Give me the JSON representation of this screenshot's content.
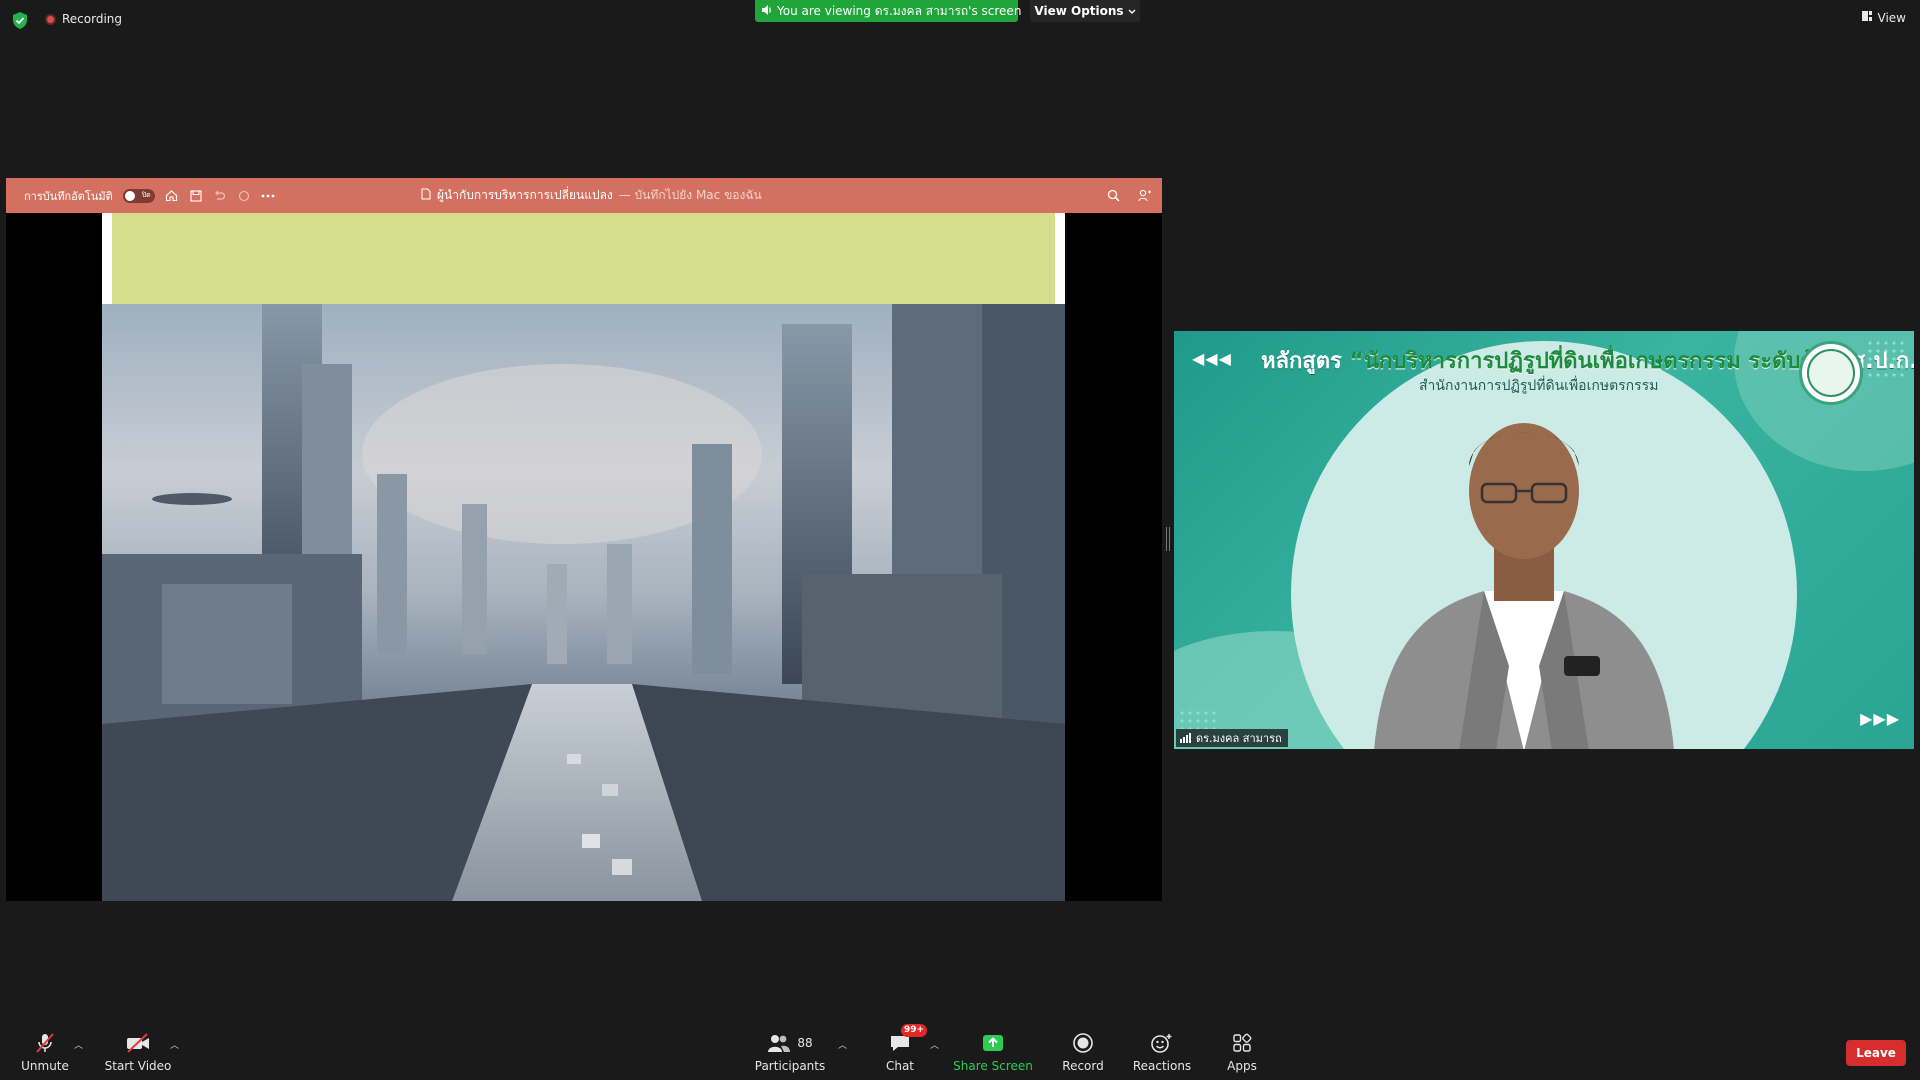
{
  "topbar": {
    "recording_label": "Recording",
    "viewing_banner": "You are viewing ดร.มงคล สามารถ's screen",
    "view_options_label": "View Options",
    "view_label": "View"
  },
  "presentation": {
    "autosave_label": "การบันทึกอัตโนมัติ",
    "toggle_state": "ปิด",
    "doc_title": "ผู้นำกับการบริหารการเปลี่ยนแปลง",
    "save_location": "— บันทึกไปยัง Mac ของฉัน"
  },
  "speaker": {
    "course_prefix": "หลักสูตร",
    "course_name": "“นักบริหารการปฏิรูปที่ดินเพื่อเกษตรกรรม ระดับต้น”",
    "course_org_abbr": "ส.ป.ก.",
    "course_org": "สำนักงานการปฏิรูปที่ดินเพื่อเกษตรกรรม",
    "name": "ดร.มงคล สามารถ",
    "arrows_left": "◀◀◀",
    "arrows_right": "▶▶▶"
  },
  "toolbar": {
    "unmute": "Unmute",
    "start_video": "Start Video",
    "participants": "Participants",
    "participants_count": "88",
    "chat": "Chat",
    "chat_badge": "99+",
    "share_screen": "Share Screen",
    "record": "Record",
    "reactions": "Reactions",
    "apps": "Apps",
    "leave": "Leave"
  },
  "colors": {
    "viewing_banner": "#1fa53a",
    "ppt_bar": "#d3705f",
    "slide_header": "#d4df8e",
    "leave_button": "#d62d2d",
    "share_screen": "#2ecc52",
    "speaker_bg": "#2aa493"
  }
}
